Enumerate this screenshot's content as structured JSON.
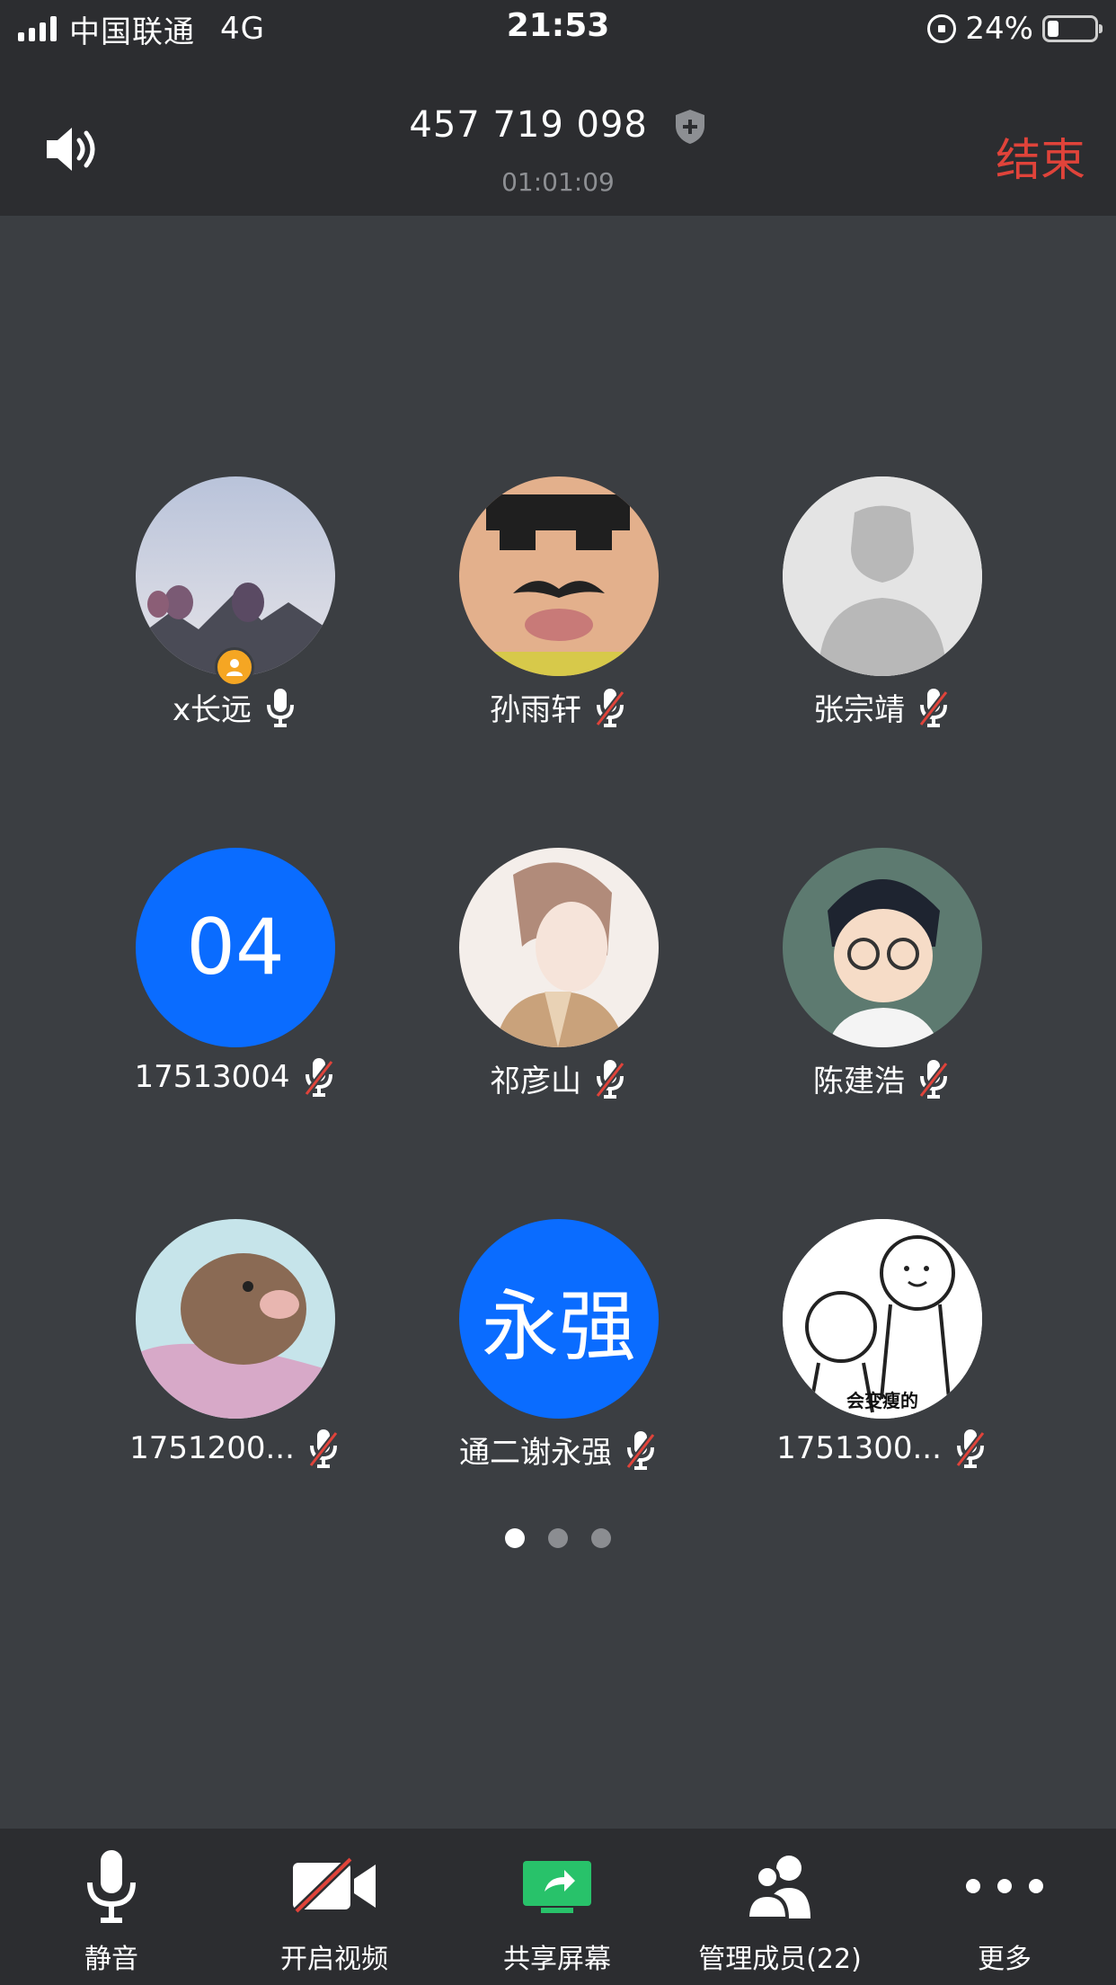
{
  "status_bar": {
    "carrier": "中国联通",
    "network": "4G",
    "time": "21:53",
    "battery_text": "24%",
    "battery_level": 0.24
  },
  "header": {
    "meeting_id": "457 719 098",
    "duration": "01:01:09",
    "end_label": "结束",
    "colors": {
      "end": "#e0433a"
    }
  },
  "participants": [
    {
      "name": "x长远",
      "mic": "on",
      "avatar": "photo-balloons",
      "host": true
    },
    {
      "name": "孙雨轩",
      "mic": "muted",
      "avatar": "photo-funny-face"
    },
    {
      "name": "张宗靖",
      "mic": "muted",
      "avatar": "default-person"
    },
    {
      "name": "17513004",
      "mic": "muted",
      "avatar_text": "04",
      "avatar_color": "#0a6cff"
    },
    {
      "name": "祁彦山",
      "mic": "muted",
      "avatar": "illustration-boy"
    },
    {
      "name": "陈建浩",
      "mic": "muted",
      "avatar": "illustration-conan"
    },
    {
      "name": "1751200...",
      "mic": "muted",
      "avatar": "illustration-pig"
    },
    {
      "name": "通二谢永强",
      "mic": "muted",
      "avatar_text": "永强",
      "avatar_color": "#0a6cff"
    },
    {
      "name": "1751300...",
      "mic": "muted",
      "avatar": "doodle-hug",
      "avatar_caption": "会变瘦的"
    }
  ],
  "pager": {
    "pages": 3,
    "current": 1
  },
  "toolbar": {
    "mute": "静音",
    "video": "开启视频",
    "share": "共享屏幕",
    "members": "管理成员(22)",
    "more": "更多",
    "colors": {
      "share_icon": "#28c26a"
    }
  }
}
